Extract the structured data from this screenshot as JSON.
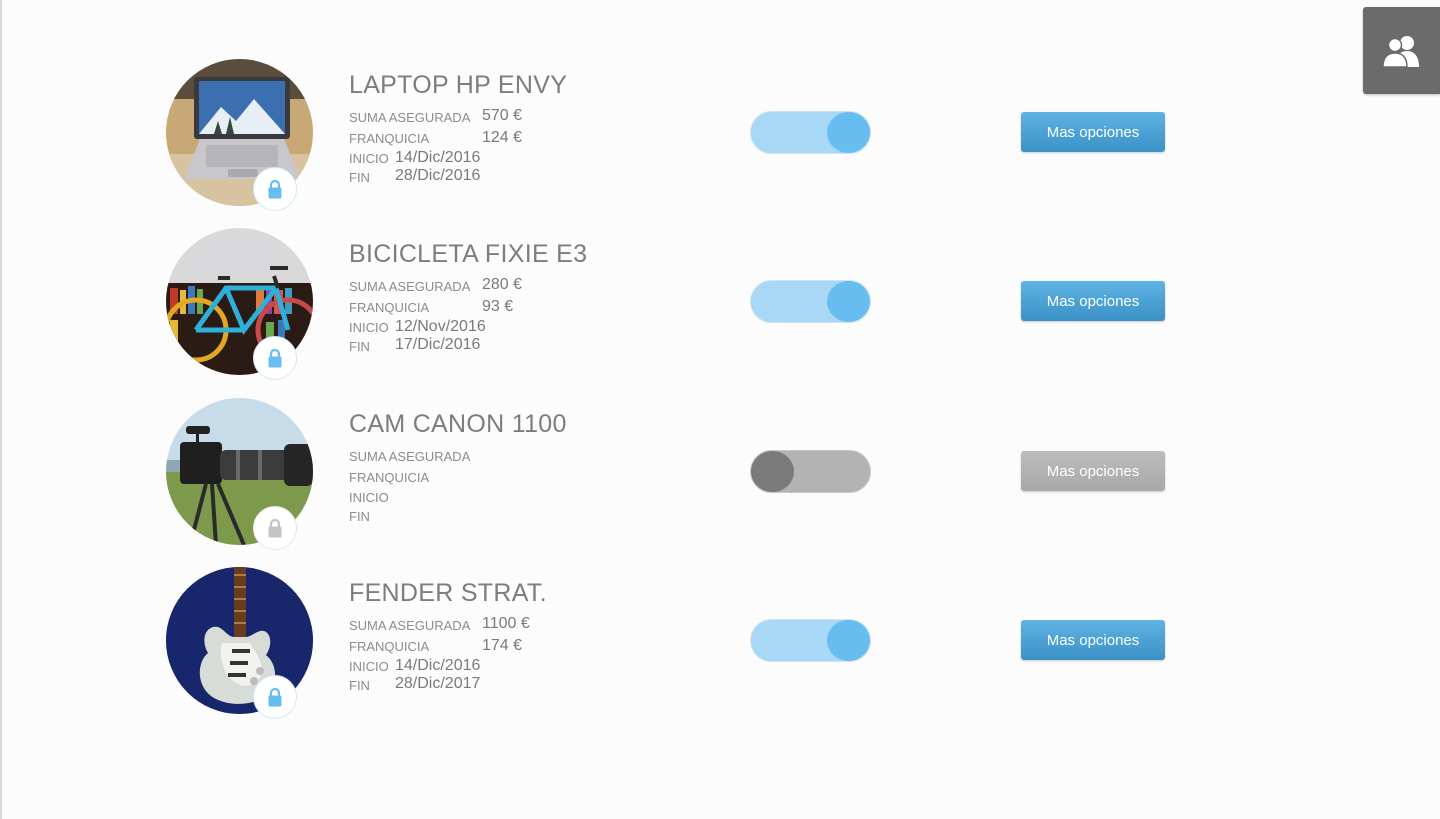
{
  "header": {
    "users_button_icon": "users-icon"
  },
  "items": [
    {
      "name": "LAPTOP HP ENVY",
      "image": "laptop-photo",
      "suma_label": "SUMA ASEGURADA",
      "suma_value": "570  €",
      "franquicia_label": "FRANQUICIA",
      "franquicia_value": "124  €",
      "inicio_label": "INICIO",
      "inicio_value": "14/Dic/2016",
      "fin_label": "FIN",
      "fin_value": "28/Dic/2016",
      "active": true,
      "button_label": "Mas opciones"
    },
    {
      "name": "BICICLETA FIXIE E3",
      "image": "bicycle-photo",
      "suma_label": "SUMA ASEGURADA",
      "suma_value": "280  €",
      "franquicia_label": "FRANQUICIA",
      "franquicia_value": "93  €",
      "inicio_label": "INICIO",
      "inicio_value": "12/Nov/2016",
      "fin_label": "FIN",
      "fin_value": "17/Dic/2016",
      "active": true,
      "button_label": "Mas opciones"
    },
    {
      "name": "CAM CANON 1100",
      "image": "camera-photo",
      "suma_label": "SUMA ASEGURADA",
      "suma_value": "",
      "franquicia_label": "FRANQUICIA",
      "franquicia_value": "",
      "inicio_label": "INICIO",
      "inicio_value": "",
      "fin_label": "FIN",
      "fin_value": "",
      "active": false,
      "button_label": "Mas opciones"
    },
    {
      "name": "FENDER STRAT.",
      "image": "guitar-photo",
      "suma_label": "SUMA ASEGURADA",
      "suma_value": "1100  €",
      "franquicia_label": "FRANQUICIA",
      "franquicia_value": "174  €",
      "inicio_label": "INICIO",
      "inicio_value": "14/Dic/2016",
      "fin_label": "FIN",
      "fin_value": "28/Dic/2017",
      "active": true,
      "button_label": "Mas opciones"
    }
  ],
  "colors": {
    "accent": "#5fb2e4",
    "toggle_on_track": "#a9d8f6",
    "toggle_on_knob": "#68bdf0",
    "toggle_off_track": "#b3b3b3",
    "toggle_off_knob": "#7a7a7a",
    "user_button_bg": "#6b6b6b"
  }
}
